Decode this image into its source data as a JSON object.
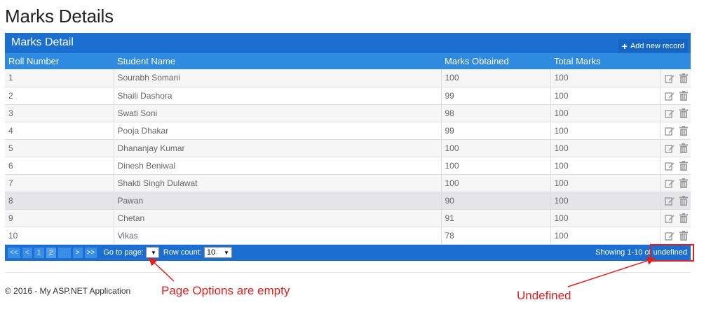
{
  "page": {
    "title": "Marks Details"
  },
  "grid": {
    "title": "Marks Detail",
    "add_label": "Add new record",
    "columns": [
      "Roll Number",
      "Student Name",
      "Marks Obtained",
      "Total Marks"
    ],
    "rows": [
      [
        "1",
        "Sourabh Somani",
        "100",
        "100"
      ],
      [
        "2",
        "Shaili Dashora",
        "99",
        "100"
      ],
      [
        "3",
        "Swati Soni",
        "98",
        "100"
      ],
      [
        "4",
        "Pooja Dhakar",
        "99",
        "100"
      ],
      [
        "5",
        "Dhananjay Kumar",
        "100",
        "100"
      ],
      [
        "6",
        "Dinesh Beniwal",
        "100",
        "100"
      ],
      [
        "7",
        "Shakti Singh Dulawat",
        "100",
        "100"
      ],
      [
        "8",
        "Pawan",
        "90",
        "100"
      ],
      [
        "9",
        "Chetan",
        "91",
        "100"
      ],
      [
        "10",
        "Vikas",
        "78",
        "100"
      ]
    ],
    "selected_row": 8,
    "action_icons": [
      "edit-icon",
      "trash-icon"
    ]
  },
  "pager": {
    "first": "<<",
    "prev": "<",
    "pages": [
      "1",
      "2"
    ],
    "current_page": "2",
    "next": ">",
    "last": ">>",
    "goto_label": "Go to page:",
    "goto_value": "",
    "rowcount_label": "Row count:",
    "rowcount_value": "10",
    "showing_prefix": "Showing 1-10 of ",
    "showing_total": "undefined"
  },
  "footer": {
    "text": "© 2016 - My ASP.NET Application"
  },
  "annotations": {
    "page_options": "Page Options are empty",
    "undefined": "Undefined",
    "color": "#e02020"
  },
  "colors": {
    "header_bar": "#1a6fd0",
    "column_header": "#2e8be0",
    "pager_button": "#3a8de6"
  }
}
